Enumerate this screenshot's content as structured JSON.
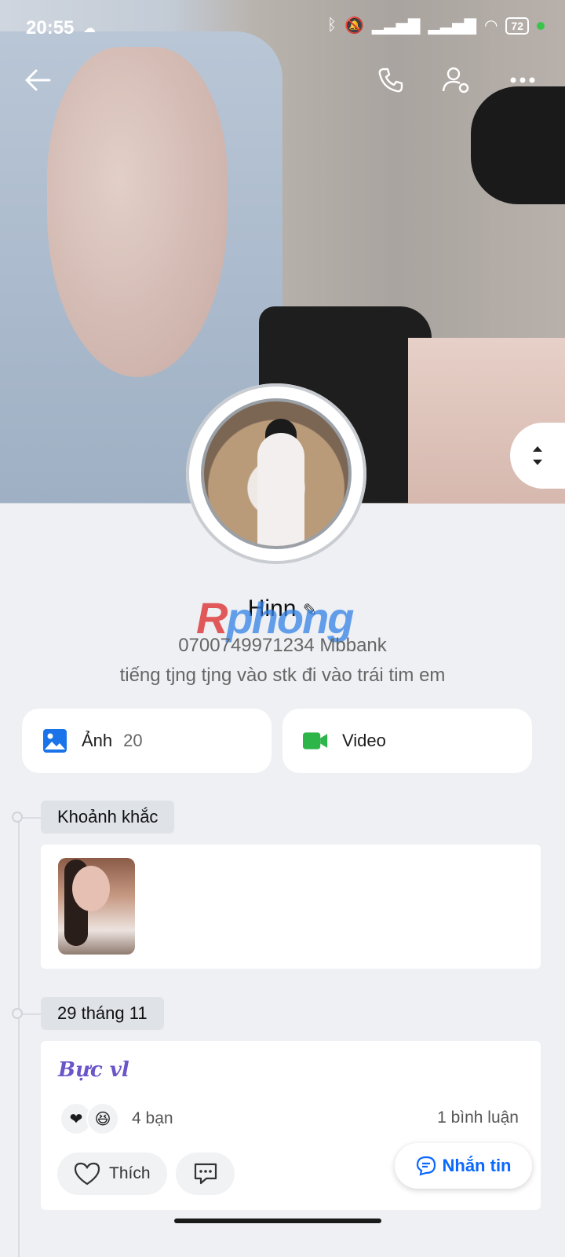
{
  "status_bar": {
    "time": "20:55",
    "battery": "72"
  },
  "profile": {
    "name": "Hinn",
    "subtitle": "0700749971234 Mbbank",
    "status": "tiếng tjng tjng vào stk đi vào trái tim em"
  },
  "watermark": {
    "r": "R",
    "rest": "phong"
  },
  "media": {
    "photos_label": "Ảnh",
    "photos_count": "20",
    "video_label": "Video"
  },
  "timeline": {
    "moments_label": "Khoảnh khắc",
    "date_label": "29 tháng 11"
  },
  "post": {
    "title": "Bực vl",
    "reactions": [
      "heart",
      "laugh"
    ],
    "friends": "4 bạn",
    "comments": "1 bình luận",
    "like_label": "Thích"
  },
  "message_button": "Nhắn tin",
  "colors": {
    "accent": "#0a68ff",
    "photo_icon": "#1a73e8",
    "video_icon": "#2db54a",
    "post_title": "#6a55c9"
  }
}
